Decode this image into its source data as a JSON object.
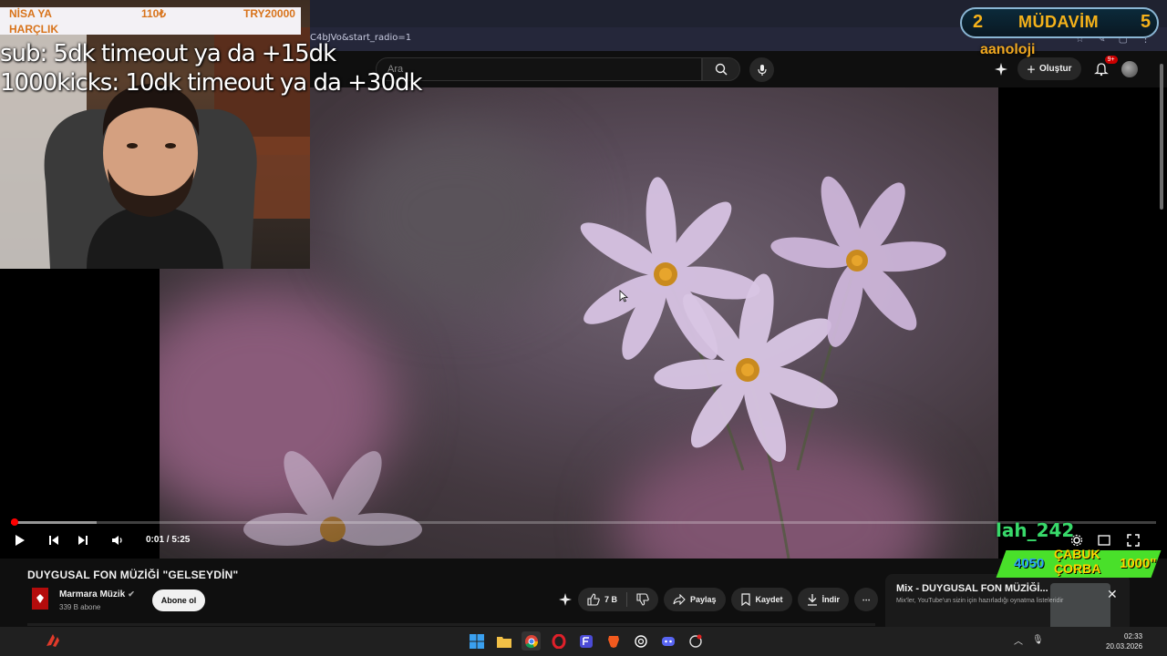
{
  "browser": {
    "url_fragment": "C4bJVo&start_radio=1"
  },
  "header": {
    "search_placeholder": "Ara",
    "create_label": "Oluştur",
    "notif_badge": "9+"
  },
  "player": {
    "current_time": "0:01",
    "duration": "5:25",
    "time_display": "0:01 / 5:25",
    "progress_fraction": 0.003,
    "buffer_fraction": 0.075
  },
  "video": {
    "title": "DUYGUSAL FON MÜZİĞİ \"GELSEYDİN\"",
    "channel_name": "Marmara Müzik",
    "subscribers": "339 B abone",
    "subscribe_label": "Abone ol",
    "like_count": "7 B",
    "share_label": "Paylaş",
    "save_label": "Kaydet",
    "download_label": "İndir"
  },
  "mix": {
    "title": "Mix - DUYGUSAL FON MÜZİĞİ...",
    "subtitle": "Mix'ler, YouTube'un sizin için hazırladığı oynatma listeleridir"
  },
  "overlay": {
    "donation_name": "NİSA YA",
    "donation_name2": "HARÇLIK",
    "donation_amount1": "110₺",
    "donation_amount2": "TRY20000",
    "line1": "sub: 5dk timeout ya da +15dk",
    "line2": "1000kicks: 10dk timeout ya da +30dk",
    "mudavim_left": "2",
    "mudavim_label": "MÜDAVİM",
    "mudavim_right": "5",
    "uploader": "aanoloji",
    "alert_user": "lah_242",
    "alert_num1": "4050",
    "alert_mid1": "ÇABUK",
    "alert_mid2": "ÇORBA",
    "alert_num2": "1000\""
  },
  "taskbar": {
    "time": "02:33",
    "date": "20.03.2026"
  }
}
